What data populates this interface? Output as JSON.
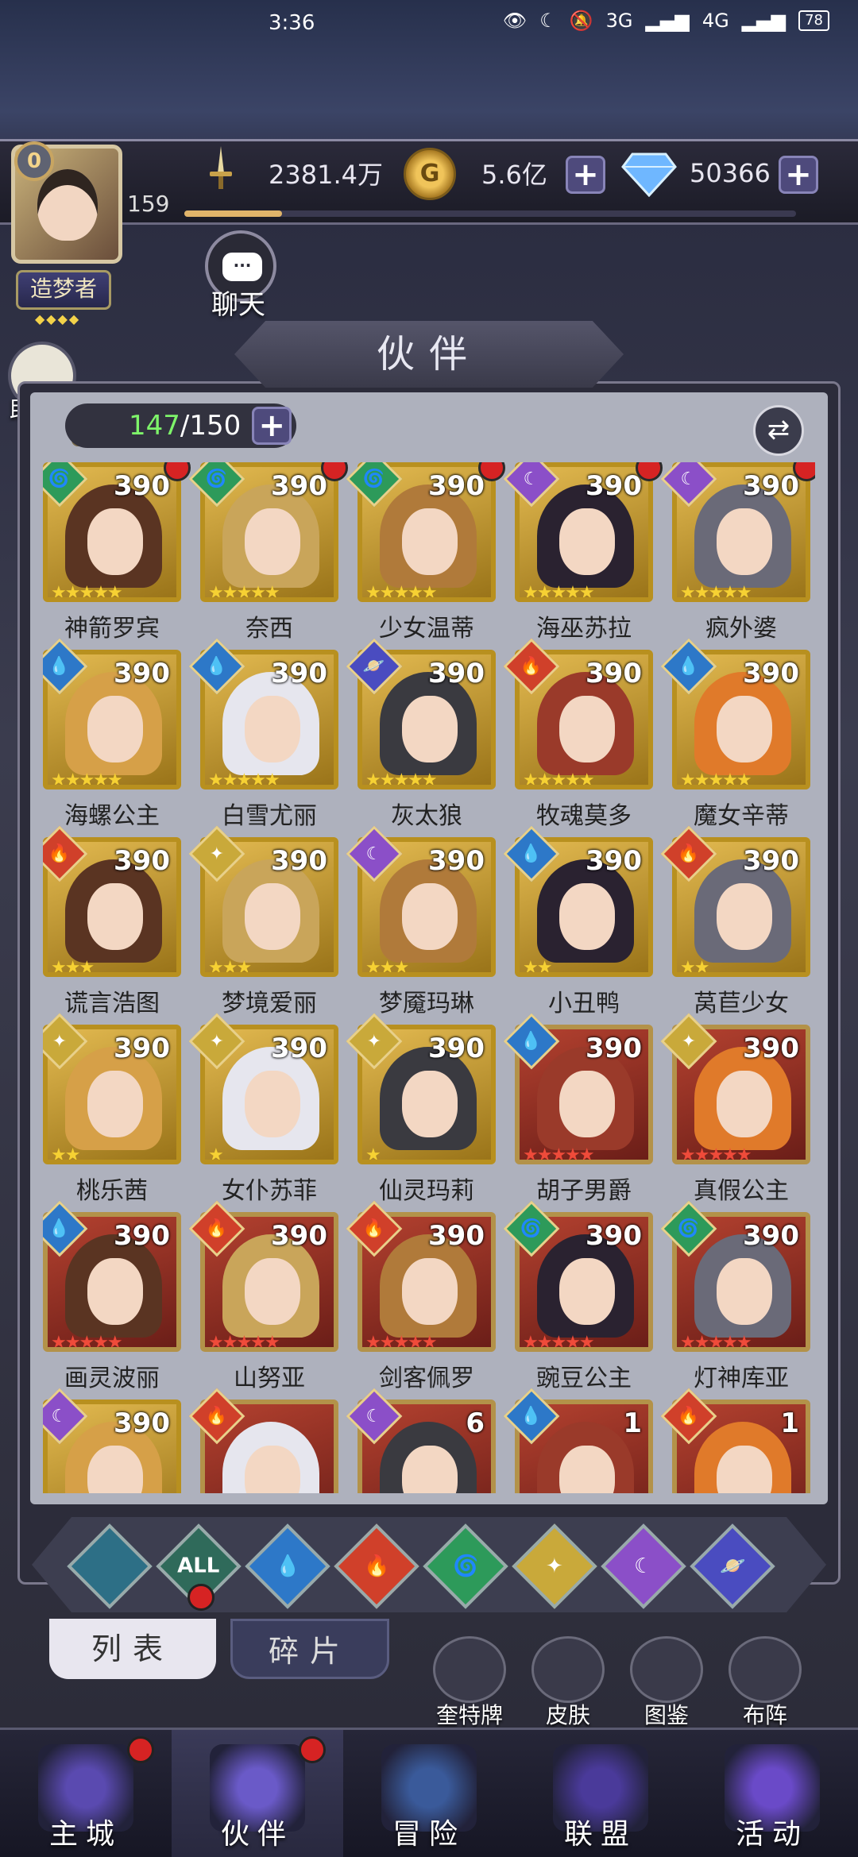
{
  "status": {
    "time": "3:36",
    "network1": "3G",
    "network2": "4G",
    "battery": "78"
  },
  "player": {
    "vip": "0",
    "level": "159",
    "badge": "造梦者"
  },
  "resources": {
    "power": "2381.4万",
    "gold": "5.6亿",
    "gems": "50366"
  },
  "chat_label": "聊天",
  "helper_label": "助手",
  "page_title": "伙伴",
  "roster": {
    "owned": "147",
    "max": "/150"
  },
  "heroes": [
    {
      "name": "神箭罗宾",
      "level": "390",
      "element": "wind",
      "frame": "gold",
      "stars": "★★★★★",
      "star_color": "y",
      "dot": true
    },
    {
      "name": "奈西",
      "level": "390",
      "element": "wind",
      "frame": "gold",
      "stars": "★★★★★",
      "star_color": "y",
      "dot": true
    },
    {
      "name": "少女温蒂",
      "level": "390",
      "element": "wind",
      "frame": "gold",
      "stars": "★★★★★",
      "star_color": "y",
      "dot": true
    },
    {
      "name": "海巫苏拉",
      "level": "390",
      "element": "dark",
      "frame": "gold",
      "stars": "★★★★★",
      "star_color": "y",
      "dot": true
    },
    {
      "name": "疯外婆",
      "level": "390",
      "element": "dark",
      "frame": "gold",
      "stars": "★★★★★",
      "star_color": "y",
      "dot": true
    },
    {
      "name": "海螺公主",
      "level": "390",
      "element": "water",
      "frame": "gold",
      "stars": "★★★★★",
      "star_color": "y",
      "dot": false
    },
    {
      "name": "白雪尤丽",
      "level": "390",
      "element": "water",
      "frame": "gold",
      "stars": "★★★★★",
      "star_color": "y",
      "dot": false
    },
    {
      "name": "灰太狼",
      "level": "390",
      "element": "cosmic",
      "frame": "gold",
      "stars": "★★★★★",
      "star_color": "y",
      "dot": false
    },
    {
      "name": "牧魂莫多",
      "level": "390",
      "element": "fire",
      "frame": "gold",
      "stars": "★★★★★",
      "star_color": "y",
      "dot": false
    },
    {
      "name": "魔女辛蒂",
      "level": "390",
      "element": "water",
      "frame": "gold",
      "stars": "★★★★★",
      "star_color": "y",
      "dot": false
    },
    {
      "name": "谎言浩图",
      "level": "390",
      "element": "fire",
      "frame": "gold",
      "stars": "★★★",
      "star_color": "y",
      "dot": false
    },
    {
      "name": "梦境爱丽",
      "level": "390",
      "element": "light",
      "frame": "gold",
      "stars": "★★★",
      "star_color": "y",
      "dot": false
    },
    {
      "name": "梦魇玛琳",
      "level": "390",
      "element": "dark",
      "frame": "gold",
      "stars": "★★★",
      "star_color": "y",
      "dot": false
    },
    {
      "name": "小丑鸭",
      "level": "390",
      "element": "water",
      "frame": "gold",
      "stars": "★★",
      "star_color": "y",
      "dot": false
    },
    {
      "name": "莴苣少女",
      "level": "390",
      "element": "fire",
      "frame": "gold",
      "stars": "★★",
      "star_color": "y",
      "dot": false
    },
    {
      "name": "桃乐茜",
      "level": "390",
      "element": "light",
      "frame": "gold",
      "stars": "★★",
      "star_color": "y",
      "dot": false
    },
    {
      "name": "女仆苏菲",
      "level": "390",
      "element": "light",
      "frame": "gold",
      "stars": "★",
      "star_color": "y",
      "dot": false
    },
    {
      "name": "仙灵玛莉",
      "level": "390",
      "element": "light",
      "frame": "gold",
      "stars": "★",
      "star_color": "y",
      "dot": false
    },
    {
      "name": "胡子男爵",
      "level": "390",
      "element": "water",
      "frame": "red",
      "stars": "★★★★★",
      "star_color": "r",
      "dot": false
    },
    {
      "name": "真假公主",
      "level": "390",
      "element": "light",
      "frame": "red",
      "stars": "★★★★★",
      "star_color": "r",
      "dot": false
    },
    {
      "name": "画灵波丽",
      "level": "390",
      "element": "water",
      "frame": "red",
      "stars": "★★★★★",
      "star_color": "r",
      "dot": false
    },
    {
      "name": "山努亚",
      "level": "390",
      "element": "fire",
      "frame": "red",
      "stars": "★★★★★",
      "star_color": "r",
      "dot": false
    },
    {
      "name": "剑客佩罗",
      "level": "390",
      "element": "fire",
      "frame": "red",
      "stars": "★★★★★",
      "star_color": "r",
      "dot": false
    },
    {
      "name": "豌豆公主",
      "level": "390",
      "element": "wind",
      "frame": "red",
      "stars": "★★★★★",
      "star_color": "r",
      "dot": false
    },
    {
      "name": "灯神库亚",
      "level": "390",
      "element": "wind",
      "frame": "red",
      "stars": "★★★★★",
      "star_color": "r",
      "dot": false
    },
    {
      "name": "",
      "level": "390",
      "element": "dark",
      "frame": "gold",
      "stars": "",
      "star_color": "y",
      "dot": false
    },
    {
      "name": "",
      "level": "",
      "element": "fire",
      "frame": "red",
      "stars": "",
      "star_color": "r",
      "dot": false
    },
    {
      "name": "",
      "level": "6",
      "element": "dark",
      "frame": "red",
      "stars": "",
      "star_color": "r",
      "dot": false
    },
    {
      "name": "",
      "level": "1",
      "element": "water",
      "frame": "red",
      "stars": "",
      "star_color": "r",
      "dot": false
    },
    {
      "name": "",
      "level": "1",
      "element": "fire",
      "frame": "red",
      "stars": "",
      "star_color": "r",
      "dot": false
    }
  ],
  "element_colors": {
    "wind": "#2d9a5a",
    "dark": "#8b4fc8",
    "water": "#2d78c8",
    "fire": "#d0402a",
    "light": "#c9a93a",
    "cosmic": "#4a4cc0"
  },
  "filters": [
    {
      "id": "special",
      "label": "",
      "color": "#2d6f86"
    },
    {
      "id": "all",
      "label": "ALL",
      "color": "#2f6a5a"
    },
    {
      "id": "water",
      "label": "💧",
      "color": "#2d78c8"
    },
    {
      "id": "fire",
      "label": "🔥",
      "color": "#d0402a"
    },
    {
      "id": "wind",
      "label": "🌀",
      "color": "#2d9a5a"
    },
    {
      "id": "light",
      "label": "✦",
      "color": "#c9a93a"
    },
    {
      "id": "dark",
      "label": "☾",
      "color": "#8b4fc8"
    },
    {
      "id": "cosmic",
      "label": "🪐",
      "color": "#4a4cc0"
    }
  ],
  "tabs": {
    "list": "列表",
    "fragments": "碎片"
  },
  "side_buttons": [
    "奎特牌",
    "皮肤",
    "图鉴",
    "布阵"
  ],
  "nav": [
    {
      "label": "主城",
      "dot": true
    },
    {
      "label": "伙伴",
      "dot": true
    },
    {
      "label": "冒险",
      "dot": false
    },
    {
      "label": "联盟",
      "dot": false
    },
    {
      "label": "活动",
      "dot": false
    }
  ]
}
